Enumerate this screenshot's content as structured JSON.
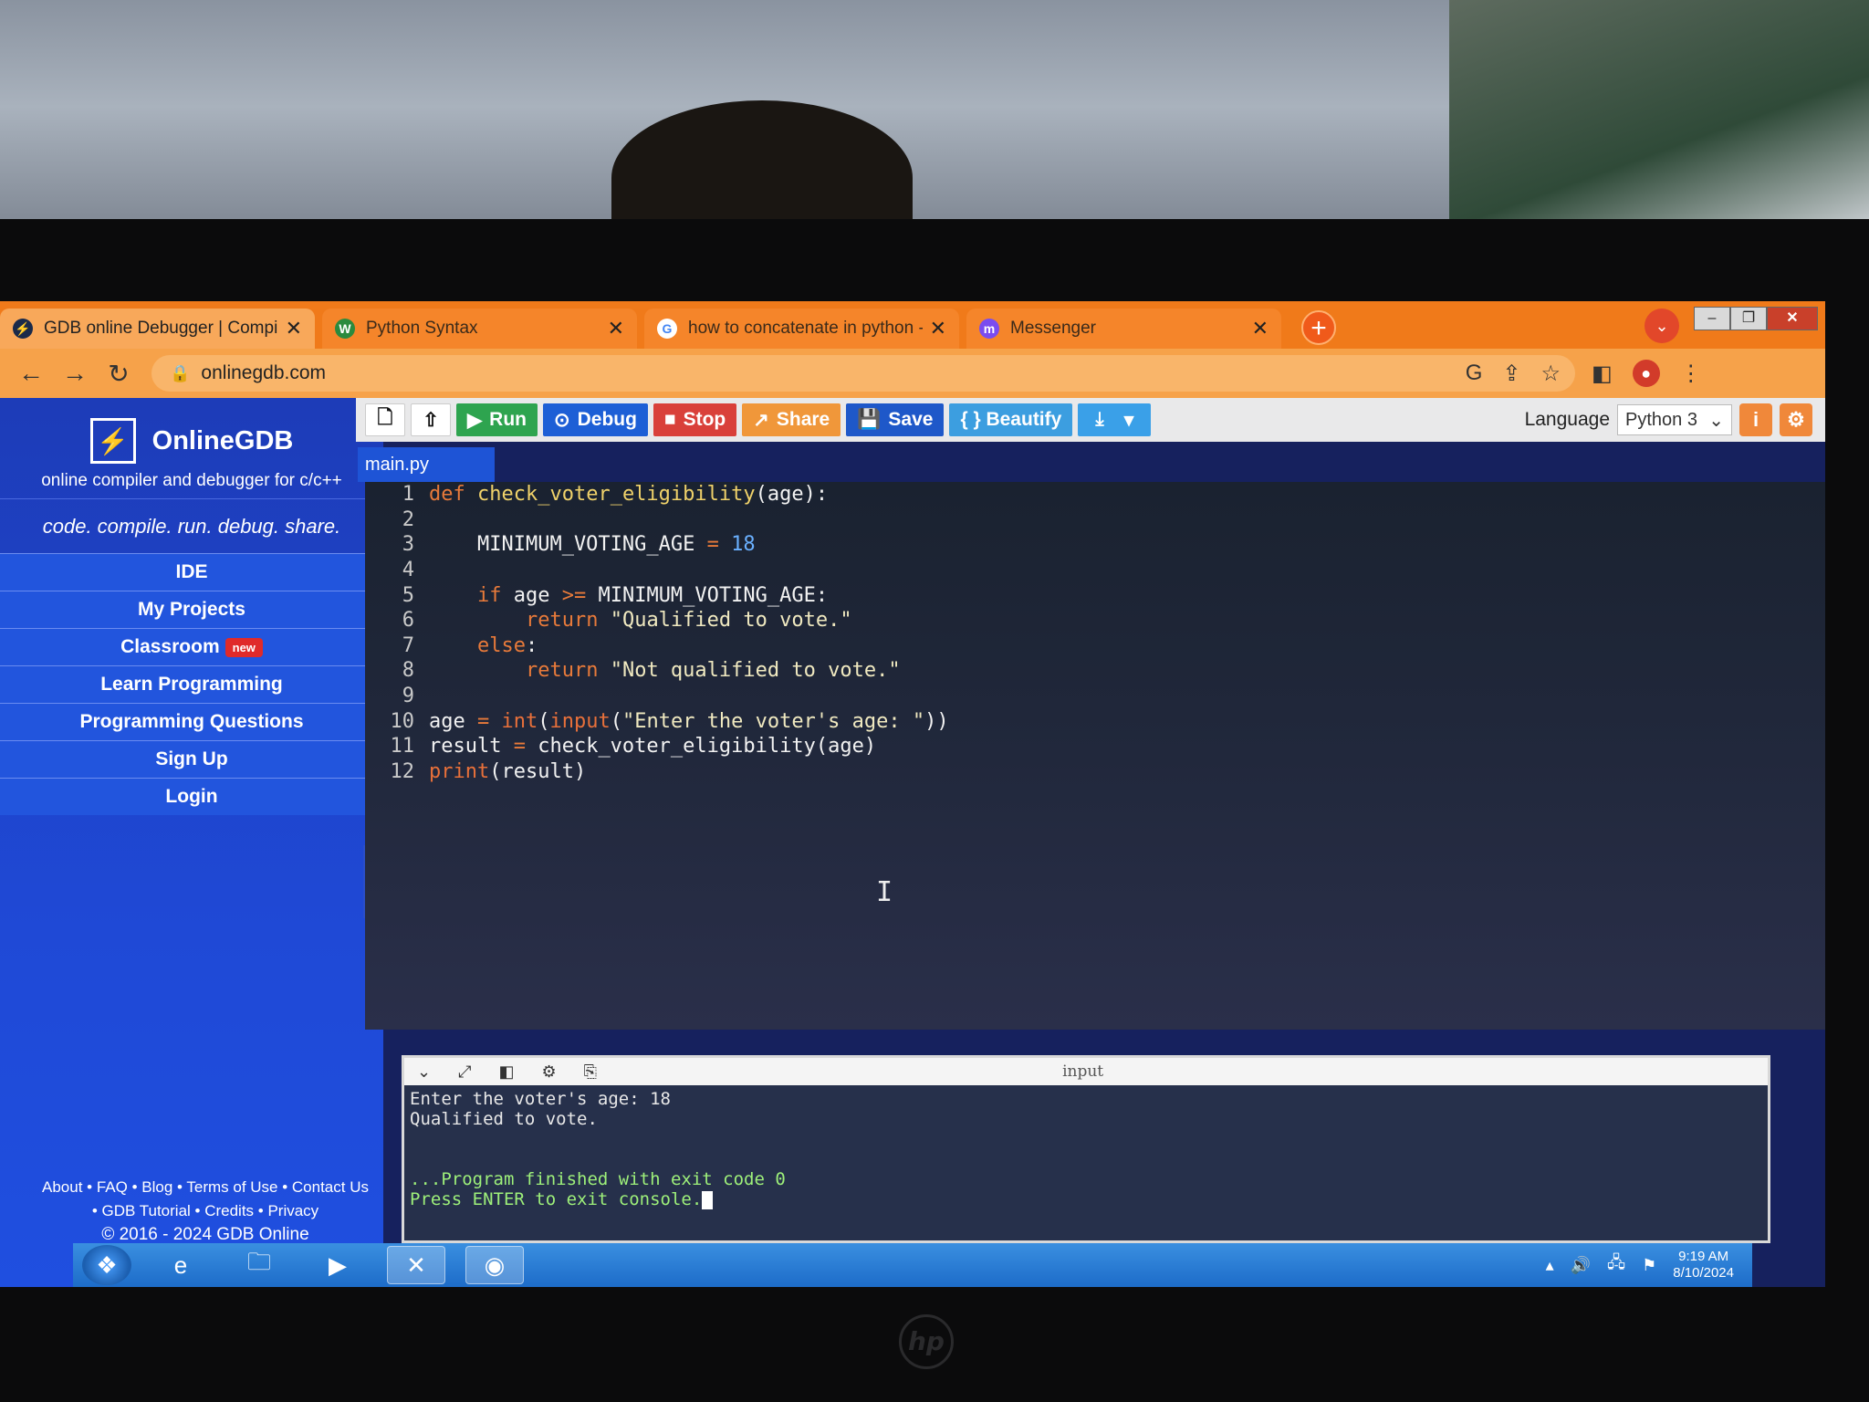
{
  "browser": {
    "tabs": [
      {
        "title": "GDB online Debugger | Compiler",
        "active": true,
        "fav": "gdb-icon"
      },
      {
        "title": "Python Syntax",
        "active": false,
        "fav": "w3schools-icon"
      },
      {
        "title": "how to concatenate in python - (",
        "active": false,
        "fav": "google-icon"
      },
      {
        "title": "Messenger",
        "active": false,
        "fav": "messenger-icon"
      }
    ],
    "url": "onlinegdb.com"
  },
  "sidebar": {
    "brand_name": "OnlineGDB",
    "brand_sub": "online compiler and debugger for c/c++",
    "tagline": "code. compile. run. debug. share.",
    "menu": [
      "IDE",
      "My Projects",
      "Classroom",
      "Learn Programming",
      "Programming Questions",
      "Sign Up",
      "Login"
    ],
    "new_badge": "new",
    "footer_line1": "About • FAQ • Blog • Terms of Use • Contact Us",
    "footer_line2": "• GDB Tutorial • Credits • Privacy",
    "copyright": "© 2016 - 2024 GDB Online"
  },
  "toolbar": {
    "run": "Run",
    "debug": "Debug",
    "stop": "Stop",
    "share": "Share",
    "save": "Save",
    "beautify": "{ } Beautify",
    "language_label": "Language",
    "language_value": "Python 3"
  },
  "editor": {
    "file_name": "main.py",
    "line_numbers": [
      "1",
      "2",
      "3",
      "4",
      "5",
      "6",
      "7",
      "8",
      "9",
      "10",
      "11",
      "12"
    ]
  },
  "console": {
    "label": "input",
    "line1": "Enter the voter's age: 18",
    "line2": "Qualified to vote.",
    "line3": "...Program finished with exit code 0",
    "line4": "Press ENTER to exit console."
  },
  "taskbar": {
    "time": "9:19 AM",
    "date": "8/10/2024"
  },
  "colors": {
    "tabbar": "#f07a1a",
    "sidebar": "#1f49d6",
    "run": "#2ea44f",
    "stop": "#d9403a"
  }
}
